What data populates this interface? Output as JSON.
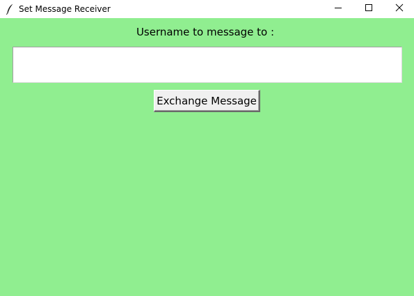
{
  "window": {
    "title": "Set Message Receiver",
    "app_icon": "feather-icon",
    "controls": {
      "minimize_icon": "minimize-icon",
      "maximize_icon": "maximize-icon",
      "close_icon": "close-icon"
    },
    "background_color": "#90ee90"
  },
  "form": {
    "prompt_label": "Username to message to :",
    "username_value": "",
    "submit_label": "Exchange Message"
  }
}
